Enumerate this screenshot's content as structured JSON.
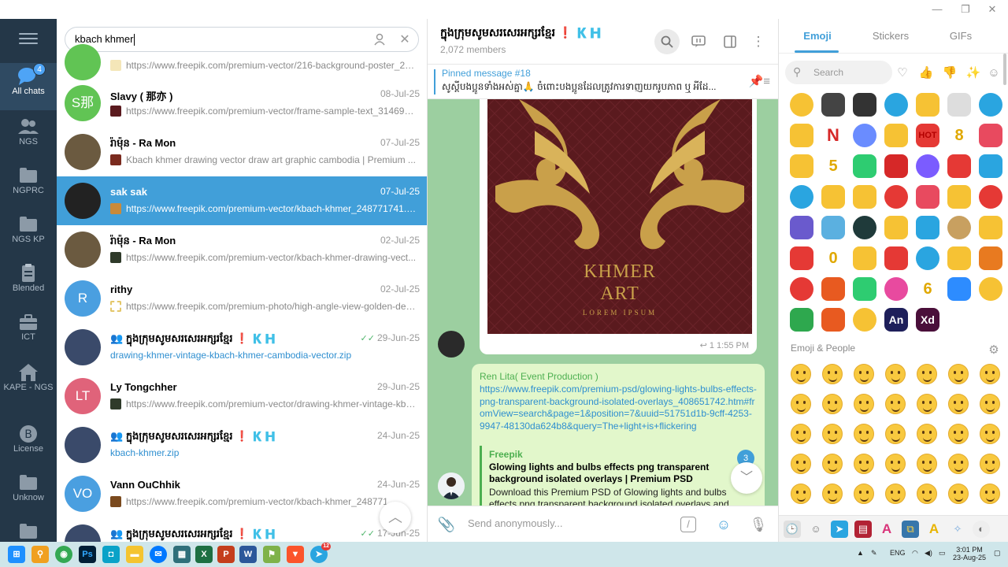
{
  "window": {
    "min": "—",
    "restore": "❐",
    "close": "✕"
  },
  "rail": {
    "items": [
      {
        "label": "All chats",
        "badge": "4"
      },
      {
        "label": "NGS"
      },
      {
        "label": "NGPRC"
      },
      {
        "label": "NGS KP"
      },
      {
        "label": "Blended"
      },
      {
        "label": "ICT"
      },
      {
        "label": "KAPE - NGS"
      },
      {
        "label": "License"
      },
      {
        "label": "Unknow"
      }
    ]
  },
  "search": {
    "value": "kbach khmer"
  },
  "chats": [
    {
      "name": "",
      "date": "",
      "preview": "https://www.freepik.com/premium-vector/216-background-poster_27...",
      "avatar_text": "",
      "avatar_color": "#61c454"
    },
    {
      "name": "Slavy ( 那亦 )",
      "date": "08-Jul-25",
      "preview": "https://www.freepik.com/premium-vector/frame-sample-text_314695...",
      "avatar_text": "S那",
      "avatar_color": "#61c454"
    },
    {
      "name": "រ៉ាម៉ុន - Ra Mon",
      "date": "07-Jul-25",
      "preview": "Kbach khmer drawing vector draw art graphic cambodia | Premium ...",
      "avatar_text": "",
      "avatar_color": "#6b5a40"
    },
    {
      "name": "sak sak",
      "date": "07-Jul-25",
      "preview": "https://www.freepik.com/premium-vector/kbach-khmer_248771741.h...",
      "avatar_text": "",
      "avatar_color": "#222222"
    },
    {
      "name": "រ៉ាម៉ុន - Ra Mon",
      "date": "02-Jul-25",
      "preview": "https://www.freepik.com/premium-vector/kbach-khmer-drawing-vect...",
      "avatar_text": "",
      "avatar_color": "#6b5a40"
    },
    {
      "name": "rithy",
      "date": "02-Jul-25",
      "preview": "https://www.freepik.com/premium-photo/high-angle-view-golden-des...",
      "avatar_text": "R",
      "avatar_color": "#4a9fe0"
    },
    {
      "name": "ក្នុងក្រុមសូមសរសេរអក្សរខ្មែរ ❗ 🇰🇭",
      "date": "29-Jun-25",
      "preview": "drawing-khmer-vintage-kbach-khmer-cambodia-vector.zip",
      "avatar_text": "",
      "avatar_color": "#3a4a6a",
      "group": true,
      "sent": true
    },
    {
      "name": "Ly Tongchher",
      "date": "29-Jun-25",
      "preview": "https://www.freepik.com/premium-vector/drawing-khmer-vintage-kba...",
      "avatar_text": "LT",
      "avatar_color": "#e0637a"
    },
    {
      "name": "ក្នុងក្រុមសូមសរសេរអក្សរខ្មែរ ❗ 🇰🇭",
      "date": "24-Jun-25",
      "preview": "kbach-khmer.zip",
      "avatar_text": "",
      "avatar_color": "#3a4a6a",
      "group": true
    },
    {
      "name": "Vann OuChhik",
      "date": "24-Jun-25",
      "preview": "https://www.freepik.com/premium-vector/kbach-khmer_248771...",
      "avatar_text": "VO",
      "avatar_color": "#4a9fe0"
    },
    {
      "name": "ក្នុងក្រុមសូមសរសេរអក្សរខ្មែរ ❗ 🇰🇭",
      "date": "17-Jun-25",
      "preview": "",
      "avatar_text": "",
      "avatar_color": "#3a4a6a",
      "group": true,
      "sent": true
    }
  ],
  "chat": {
    "title": "ក្នុងក្រុមសូមសរសេរអក្សរខ្មែរ ❗ 🇰🇭",
    "members": "2,072 members",
    "pinned_title": "Pinned message #18",
    "pinned_text": "សូស្តីបងប្អូនទាំងអស់គ្នា🙏 ចំពោះបងប្អូនដែលត្រូវការទាញយករូបភាព ឬ អីដែ...",
    "image_title_1": "KHMER",
    "image_title_2": "ART",
    "image_sub": "LOREM IPSUM",
    "msg1_meta": "↩ 1  1:55 PM",
    "msg2_sender": "Ren Lita( Event Production )",
    "msg2_link": "https://www.freepik.com/premium-psd/glowing-lights-bulbs-effects-png-transparent-background-isolated-overlays_408651742.htm#fromView=search&page=1&position=7&uuid=51751d1b-9cff-4253-9947-48130da624b8&query=The+light+is+flickering",
    "preview_site": "Freepik",
    "preview_title": "Glowing lights and bulbs effects png transparent background isolated overlays | Premium PSD",
    "preview_desc": "Download this Premium PSD of Glowing lights and bulbs effects png transparent background isolated overlays and explore mi...",
    "unread": "3",
    "compose_placeholder": "Send anonymously..."
  },
  "emoji": {
    "tabs": [
      "Emoji",
      "Stickers",
      "GIFs"
    ],
    "search_placeholder": "Search",
    "section": "Emoji & People",
    "sticker_texts": [
      "HOT",
      "8",
      "5",
      "An",
      "Xd",
      "0",
      "6",
      "N"
    ]
  },
  "taskbar": {
    "lang": "ENG",
    "time": "3:01 PM",
    "date": "23-Aug-25",
    "notif": "12"
  }
}
